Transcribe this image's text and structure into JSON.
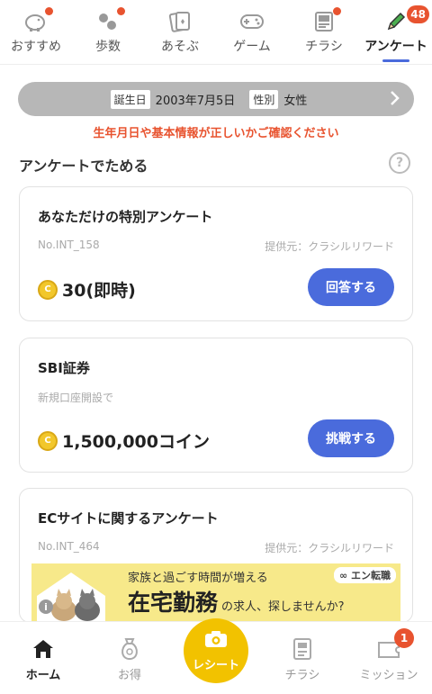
{
  "top_tabs": [
    {
      "label": "おすすめ",
      "icon": "piggy-bank-icon",
      "dot": true
    },
    {
      "label": "歩数",
      "icon": "footprints-icon",
      "dot": true
    },
    {
      "label": "あそぶ",
      "icon": "cards-icon",
      "dot": false
    },
    {
      "label": "ゲーム",
      "icon": "gamepad-icon",
      "dot": false
    },
    {
      "label": "チラシ",
      "icon": "flyer-icon",
      "dot": true
    },
    {
      "label": "アンケート",
      "icon": "pencil-icon",
      "badge": "48",
      "active": true
    }
  ],
  "profile": {
    "birthday_label": "誕生日",
    "birthday_value": "2003年7月5日",
    "gender_label": "性別",
    "gender_value": "女性"
  },
  "warning": "生年月日や基本情報が正しいかご確認ください",
  "section_title": "アンケートでためる",
  "help_icon_glyph": "?",
  "cards": [
    {
      "title": "あなただけの特別アンケート",
      "sub": "No.INT_158",
      "provider": "提供元：クラシルリワード",
      "reward": "30(即時)",
      "button": "回答する"
    },
    {
      "title": "SBI証券",
      "sub": "新規口座開設で",
      "provider": "",
      "reward": "1,500,000コイン",
      "button": "挑戦する"
    },
    {
      "title": "ECサイトに関するアンケート",
      "sub": "No.INT_464",
      "provider": "提供元：クラシルリワード",
      "reward": "",
      "button": ""
    }
  ],
  "coin_glyph": "C",
  "ad": {
    "line1": "家族と過ごす時間が増える",
    "big": "在宅勤務",
    "small": "の求人、探しませんか?",
    "brand": "∞ エン転職",
    "info_glyph": "i"
  },
  "bottom_nav": [
    {
      "label": "ホーム",
      "icon": "home-icon",
      "active": true
    },
    {
      "label": "お得",
      "icon": "money-bag-icon"
    },
    {
      "label": "レシート",
      "icon": "camera-icon"
    },
    {
      "label": "チラシ",
      "icon": "flyer-icon"
    },
    {
      "label": "ミッション",
      "icon": "ticket-icon",
      "badge": "1"
    }
  ],
  "colors": {
    "accent": "#4a6bdc",
    "alert": "#e8532f",
    "receipt": "#f2c200",
    "coin": "#f2c72b"
  }
}
